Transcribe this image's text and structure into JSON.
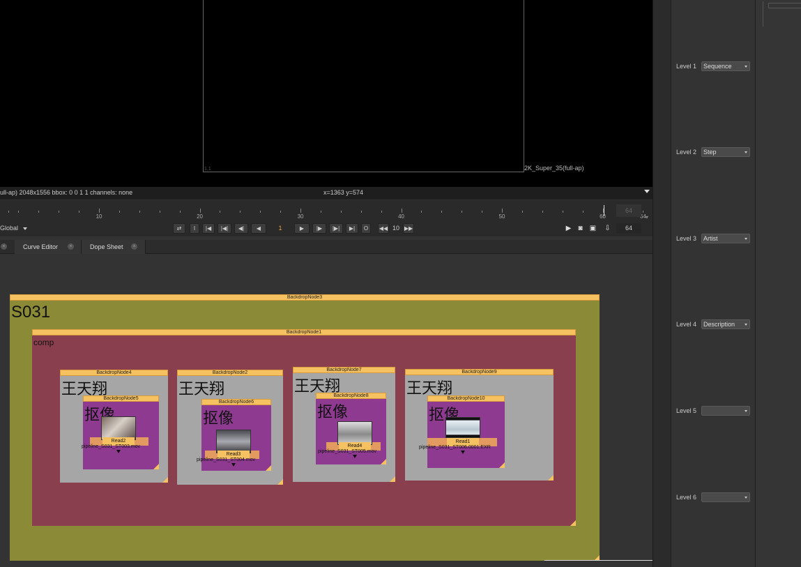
{
  "viewer": {
    "format_name": "2K_Super_35(full-ap)",
    "corner_label": "1,1",
    "info_left": "ull-ap) 2048x1556  bbox: 0 0 1 1 channels: none",
    "info_coords": "x=1363 y=574"
  },
  "timeline": {
    "tick_labels": [
      "10",
      "20",
      "30",
      "40",
      "50",
      "60",
      "64"
    ],
    "ruler_end": "64",
    "global_label": "Global",
    "current_frame": "1",
    "step": "10",
    "end_frame": "64",
    "o_label": "O",
    "i_label": "I"
  },
  "tabs": [
    {
      "label": "Curve Editor"
    },
    {
      "label": "Dope Sheet"
    }
  ],
  "nodegraph": {
    "backdrop3": {
      "title": "BackdropNode3",
      "label": "S031"
    },
    "backdrop1": {
      "title": "BackdropNode1",
      "label": "comp"
    },
    "backdrop4": {
      "title": "BackdropNode4",
      "label": "王天翔"
    },
    "backdrop5": {
      "title": "BackdropNode5",
      "label": "抠像"
    },
    "backdrop2": {
      "title": "BackdropNode2",
      "label": "王天翔"
    },
    "backdrop6": {
      "title": "BackdropNode6",
      "label": "抠像"
    },
    "backdrop7": {
      "title": "BackdropNode7",
      "label": "王天翔"
    },
    "backdrop8": {
      "title": "BackdropNode8",
      "label": "抠像"
    },
    "backdrop9": {
      "title": "BackdropNode9",
      "label": "王天翔"
    },
    "backdrop10": {
      "title": "BackdropNode10",
      "label": "抠像"
    },
    "read2": {
      "name": "Read2",
      "file": "pipeline_S031_ST003.mov"
    },
    "read3": {
      "name": "Read3",
      "file": "pipeline_S031_ST004.mov"
    },
    "read4": {
      "name": "Read4",
      "file": "pipeline_S031_ST005.mov"
    },
    "read1": {
      "name": "Read1",
      "file": "pipeline_S031_ST006.0001.EXR"
    }
  },
  "properties": {
    "levels": [
      {
        "label": "Level 1",
        "value": "Sequence"
      },
      {
        "label": "Level 2",
        "value": "Step"
      },
      {
        "label": "Level 3",
        "value": "Artist"
      },
      {
        "label": "Level 4",
        "value": "Description"
      },
      {
        "label": "Level 5",
        "value": ""
      },
      {
        "label": "Level 6",
        "value": ""
      }
    ]
  },
  "colors": {
    "backdrop_olive": "#8a8a37",
    "backdrop_maroon": "#8a3f4e",
    "backdrop_gray": "#a6a6a6",
    "backdrop_purple": "#8f3a91",
    "title_bar": "#f6c160",
    "frame_accent": "#e8a040"
  }
}
